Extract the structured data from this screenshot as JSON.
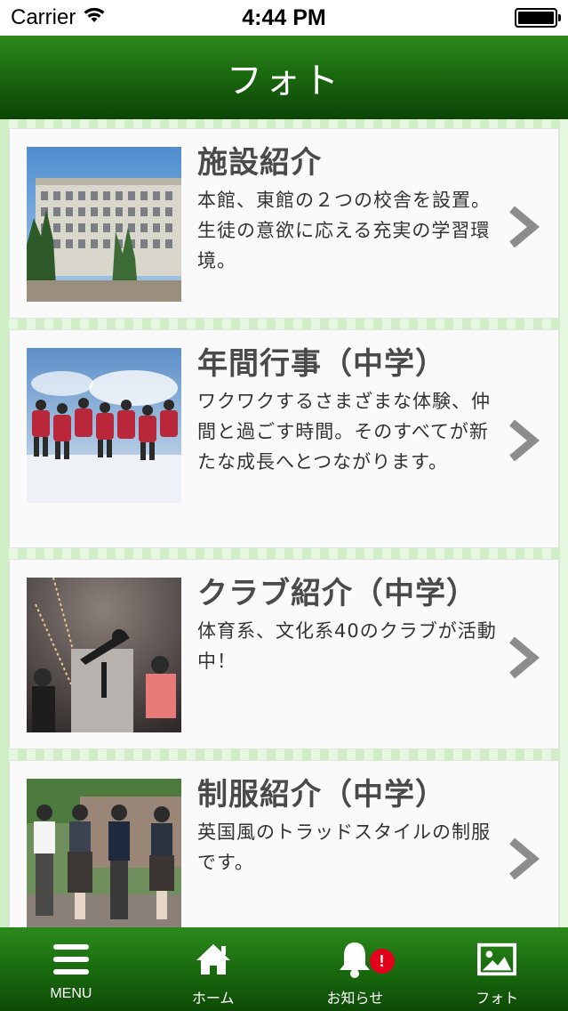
{
  "status_bar": {
    "carrier": "Carrier",
    "time": "4:44 PM"
  },
  "nav": {
    "title": "フォト"
  },
  "cards": [
    {
      "title": "施設紹介",
      "description": "本館、東館の２つの校舎を設置。生徒の意欲に応える充実の学習環境。",
      "thumb_icon": "school-building-photo"
    },
    {
      "title": "年間行事（中学）",
      "description": "ワクワクするさまざまな体験、仲間と過ごす時間。そのすべてが新たな成長へとつながります。",
      "thumb_icon": "students-jumping-snow-photo"
    },
    {
      "title": "クラブ紹介（中学）",
      "description": "体育系、文化系40のクラブが活動中！",
      "thumb_icon": "planetarium-telescope-photo"
    },
    {
      "title": "制服紹介（中学）",
      "description": "英国風のトラッドスタイルの制服です。",
      "thumb_icon": "students-uniform-photo"
    }
  ],
  "tabs": [
    {
      "label": "MENU",
      "icon": "hamburger-icon"
    },
    {
      "label": "ホーム",
      "icon": "home-icon"
    },
    {
      "label": "お知らせ",
      "icon": "bell-icon",
      "badge": "!"
    },
    {
      "label": "フォト",
      "icon": "photo-icon"
    }
  ],
  "colors": {
    "header_green": "#1b6a0f",
    "background_green": "#dff3d8",
    "badge_red": "#e3001b"
  }
}
